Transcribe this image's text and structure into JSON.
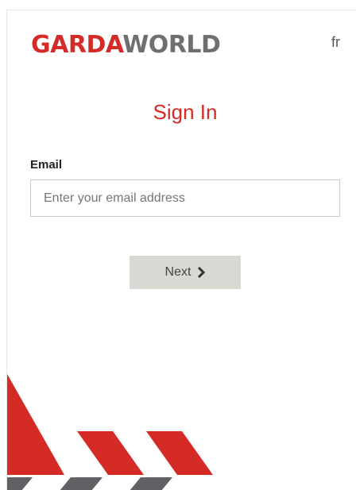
{
  "header": {
    "logo_left": "GARDA",
    "logo_right": "WORLD",
    "language_link": "fr"
  },
  "form": {
    "title": "Sign In",
    "email_label": "Email",
    "email_placeholder": "Enter your email address",
    "email_value": "",
    "next_label": "Next"
  },
  "icons": {
    "next_icon": "chevron-right-icon"
  },
  "colors": {
    "brand_red": "#d52b27",
    "brand_gray": "#6e6f71",
    "button_bg": "#d9d8d3"
  }
}
